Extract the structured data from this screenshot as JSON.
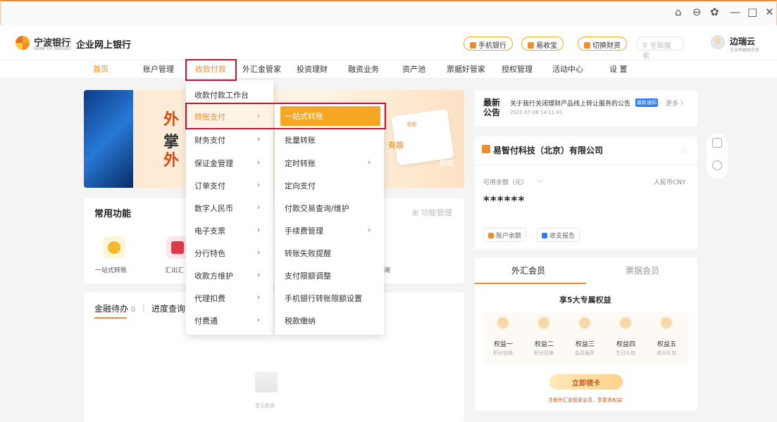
{
  "window": {
    "controls": [
      "⌂",
      "⊖",
      "✿",
      "—",
      "□",
      "✕"
    ]
  },
  "header": {
    "bank_name_cn": "宁波银行",
    "bank_name_en": "BANK OF NINGBO",
    "product": "企业网上银行",
    "pills": [
      "手机银行",
      "易收宝",
      "切换财资"
    ],
    "search_placeholder": "全局搜索",
    "user_name": "边瑞云",
    "user_role": "企业网银经办员"
  },
  "nav": {
    "items": [
      "首页",
      "账户管理",
      "收款付款",
      "外汇金管家",
      "投资理财",
      "融资业务",
      "资产池",
      "票据好管家",
      "授权管理",
      "活动中心",
      "设 置"
    ],
    "active": "收款付款"
  },
  "menu": {
    "level1": [
      "收款付款工作台",
      "转账支付",
      "财务支付",
      "保证金管理",
      "订单支付",
      "数字人民币",
      "电子支票",
      "分行特色",
      "收款方维护",
      "代理扣费",
      "付费通"
    ],
    "level1_active": "转账支付",
    "level2": [
      "一站式转账",
      "批量转账",
      "定时转账",
      "定向支付",
      "付款交易查询/维护",
      "手续费管理",
      "转账失败提醒",
      "支付限额调整",
      "手机银行转账限额设置",
      "税款缴纳"
    ],
    "level2_active": "一站式转账"
  },
  "banner": {
    "text_lines": [
      "外",
      "掌",
      "外"
    ],
    "tag1": "有趣",
    "tag2": "好玩",
    "tag3": "轻松"
  },
  "functions": {
    "title": "常用功能",
    "manage": "功能管理",
    "items": [
      "一站式转账",
      "汇出汇",
      "询"
    ]
  },
  "todo": {
    "tab1": "金融待办",
    "tab1_count": "0",
    "tab2": "进度查询",
    "empty": "暂无数据"
  },
  "news": {
    "tag_line1": "最新",
    "tag_line2": "公告",
    "title": "关于我行关闭理财产品线上转让服务的公告",
    "badge": "最新通知",
    "more": "更多 〉",
    "date": "2021-07-08 14:11:41"
  },
  "account": {
    "company": "易智付科技（北京）有限公司",
    "balance_label": "可用余额（元）",
    "currency": "人民币CNY",
    "balance": "******",
    "btn_balance": "账户余额",
    "btn_report": "收支报告"
  },
  "member": {
    "tab_active": "外汇会员",
    "tab_other": "票据会员",
    "perk_title": "享5大专属权益",
    "perks": [
      {
        "name": "权益一",
        "sub": "积分加倍"
      },
      {
        "name": "权益二",
        "sub": "积分兑换"
      },
      {
        "name": "权益三",
        "sub": "会员抽奖"
      },
      {
        "name": "权益四",
        "sub": "生日礼包"
      },
      {
        "name": "权益五",
        "sub": "成长礼包"
      }
    ],
    "cta": "立即领卡",
    "note": "注册外汇金管家会员，享更多权益"
  }
}
